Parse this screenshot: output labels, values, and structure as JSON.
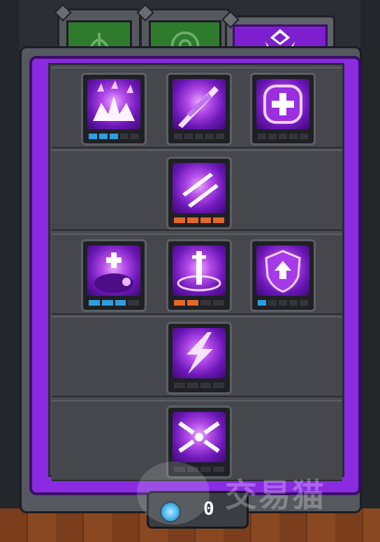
{
  "tabs": [
    {
      "icon": "bow-icon",
      "active": false
    },
    {
      "icon": "swirl-eye-icon",
      "active": false
    },
    {
      "icon": "crest-icon",
      "active": true
    }
  ],
  "skill_rows": [
    {
      "skills": [
        {
          "icon": "burst-icon",
          "level": 3,
          "max": 5,
          "bar_color": "#2f9de0"
        },
        {
          "icon": "slash-icon",
          "level": 0,
          "max": 5,
          "bar_color": "#2f9de0"
        },
        {
          "icon": "heal-cross-icon",
          "level": 0,
          "max": 5,
          "bar_color": "#2f9de0"
        }
      ]
    },
    {
      "skills": [
        {
          "icon": "flying-swords-icon",
          "level": 4,
          "max": 4,
          "bar_color": "#e2682a"
        }
      ]
    },
    {
      "skills": [
        {
          "icon": "pet-heal-icon",
          "level": 3,
          "max": 4,
          "bar_color": "#2f9de0"
        },
        {
          "icon": "sword-pillar-icon",
          "level": 2,
          "max": 4,
          "bar_color": "#e2682a"
        },
        {
          "icon": "shield-up-icon",
          "level": 1,
          "max": 5,
          "bar_color": "#2f9de0"
        }
      ]
    },
    {
      "skills": [
        {
          "icon": "lightning-strike-icon",
          "level": 0,
          "max": 4,
          "bar_color": "#2f9de0"
        }
      ]
    },
    {
      "skills": [
        {
          "icon": "sword-barrage-icon",
          "level": 0,
          "max": 4,
          "bar_color": "#2f9de0"
        }
      ]
    }
  ],
  "currency": {
    "icon": "spiral-gem-icon",
    "amount": "0"
  },
  "watermark": {
    "text": "交易猫"
  }
}
